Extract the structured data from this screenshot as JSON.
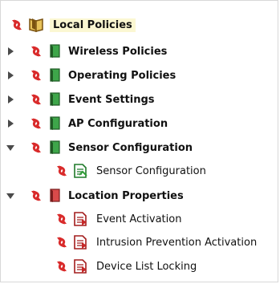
{
  "tree": {
    "root": {
      "label": "Local Policies"
    },
    "items": [
      {
        "label": "Wireless Policies",
        "expanded": false
      },
      {
        "label": "Operating Policies",
        "expanded": false
      },
      {
        "label": "Event Settings",
        "expanded": false
      },
      {
        "label": "AP Configuration",
        "expanded": false
      },
      {
        "label": "Sensor Configuration",
        "expanded": true,
        "children": [
          {
            "label": "Sensor Configuration"
          }
        ]
      },
      {
        "label": "Location Properties",
        "expanded": true,
        "children": [
          {
            "label": "Event Activation"
          },
          {
            "label": "Intrusion Prevention Activation"
          },
          {
            "label": "Device List Locking"
          }
        ]
      }
    ]
  },
  "colors": {
    "sync_red": "#d92b2b",
    "book_green": "#2e9e37",
    "book_brown": "#7a5210",
    "book_red": "#c62828",
    "highlight": "#fbf7d2",
    "arrow": "#4a4a4a"
  }
}
